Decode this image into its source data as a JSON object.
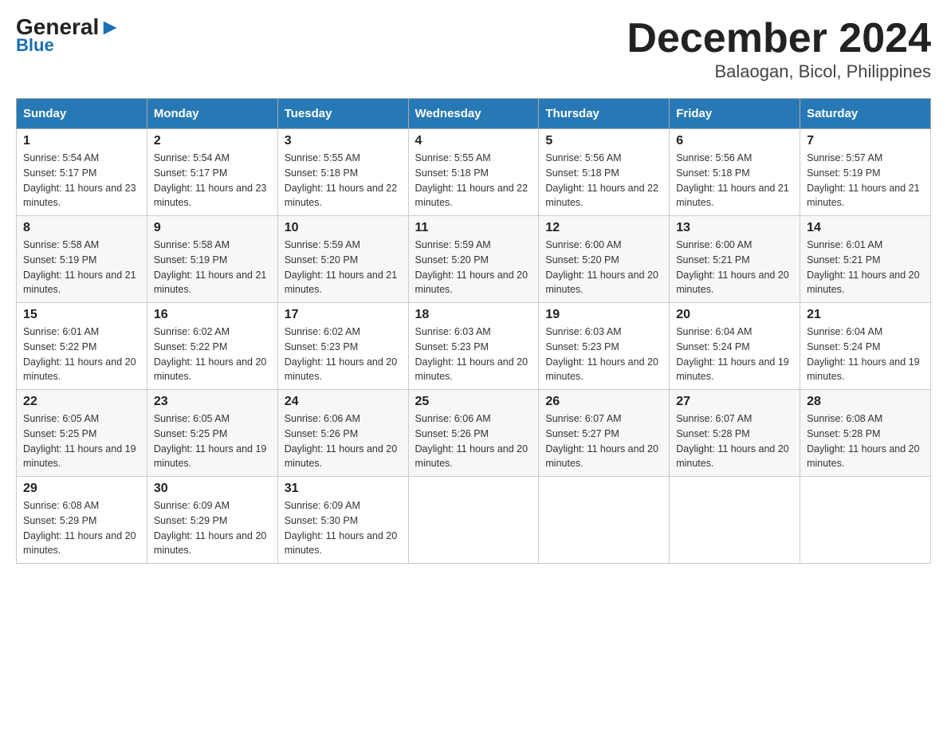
{
  "header": {
    "logo_general": "General",
    "logo_blue": "Blue",
    "title": "December 2024",
    "subtitle": "Balaogan, Bicol, Philippines"
  },
  "columns": [
    "Sunday",
    "Monday",
    "Tuesday",
    "Wednesday",
    "Thursday",
    "Friday",
    "Saturday"
  ],
  "weeks": [
    [
      {
        "day": "1",
        "sunrise": "Sunrise: 5:54 AM",
        "sunset": "Sunset: 5:17 PM",
        "daylight": "Daylight: 11 hours and 23 minutes."
      },
      {
        "day": "2",
        "sunrise": "Sunrise: 5:54 AM",
        "sunset": "Sunset: 5:17 PM",
        "daylight": "Daylight: 11 hours and 23 minutes."
      },
      {
        "day": "3",
        "sunrise": "Sunrise: 5:55 AM",
        "sunset": "Sunset: 5:18 PM",
        "daylight": "Daylight: 11 hours and 22 minutes."
      },
      {
        "day": "4",
        "sunrise": "Sunrise: 5:55 AM",
        "sunset": "Sunset: 5:18 PM",
        "daylight": "Daylight: 11 hours and 22 minutes."
      },
      {
        "day": "5",
        "sunrise": "Sunrise: 5:56 AM",
        "sunset": "Sunset: 5:18 PM",
        "daylight": "Daylight: 11 hours and 22 minutes."
      },
      {
        "day": "6",
        "sunrise": "Sunrise: 5:56 AM",
        "sunset": "Sunset: 5:18 PM",
        "daylight": "Daylight: 11 hours and 21 minutes."
      },
      {
        "day": "7",
        "sunrise": "Sunrise: 5:57 AM",
        "sunset": "Sunset: 5:19 PM",
        "daylight": "Daylight: 11 hours and 21 minutes."
      }
    ],
    [
      {
        "day": "8",
        "sunrise": "Sunrise: 5:58 AM",
        "sunset": "Sunset: 5:19 PM",
        "daylight": "Daylight: 11 hours and 21 minutes."
      },
      {
        "day": "9",
        "sunrise": "Sunrise: 5:58 AM",
        "sunset": "Sunset: 5:19 PM",
        "daylight": "Daylight: 11 hours and 21 minutes."
      },
      {
        "day": "10",
        "sunrise": "Sunrise: 5:59 AM",
        "sunset": "Sunset: 5:20 PM",
        "daylight": "Daylight: 11 hours and 21 minutes."
      },
      {
        "day": "11",
        "sunrise": "Sunrise: 5:59 AM",
        "sunset": "Sunset: 5:20 PM",
        "daylight": "Daylight: 11 hours and 20 minutes."
      },
      {
        "day": "12",
        "sunrise": "Sunrise: 6:00 AM",
        "sunset": "Sunset: 5:20 PM",
        "daylight": "Daylight: 11 hours and 20 minutes."
      },
      {
        "day": "13",
        "sunrise": "Sunrise: 6:00 AM",
        "sunset": "Sunset: 5:21 PM",
        "daylight": "Daylight: 11 hours and 20 minutes."
      },
      {
        "day": "14",
        "sunrise": "Sunrise: 6:01 AM",
        "sunset": "Sunset: 5:21 PM",
        "daylight": "Daylight: 11 hours and 20 minutes."
      }
    ],
    [
      {
        "day": "15",
        "sunrise": "Sunrise: 6:01 AM",
        "sunset": "Sunset: 5:22 PM",
        "daylight": "Daylight: 11 hours and 20 minutes."
      },
      {
        "day": "16",
        "sunrise": "Sunrise: 6:02 AM",
        "sunset": "Sunset: 5:22 PM",
        "daylight": "Daylight: 11 hours and 20 minutes."
      },
      {
        "day": "17",
        "sunrise": "Sunrise: 6:02 AM",
        "sunset": "Sunset: 5:23 PM",
        "daylight": "Daylight: 11 hours and 20 minutes."
      },
      {
        "day": "18",
        "sunrise": "Sunrise: 6:03 AM",
        "sunset": "Sunset: 5:23 PM",
        "daylight": "Daylight: 11 hours and 20 minutes."
      },
      {
        "day": "19",
        "sunrise": "Sunrise: 6:03 AM",
        "sunset": "Sunset: 5:23 PM",
        "daylight": "Daylight: 11 hours and 20 minutes."
      },
      {
        "day": "20",
        "sunrise": "Sunrise: 6:04 AM",
        "sunset": "Sunset: 5:24 PM",
        "daylight": "Daylight: 11 hours and 19 minutes."
      },
      {
        "day": "21",
        "sunrise": "Sunrise: 6:04 AM",
        "sunset": "Sunset: 5:24 PM",
        "daylight": "Daylight: 11 hours and 19 minutes."
      }
    ],
    [
      {
        "day": "22",
        "sunrise": "Sunrise: 6:05 AM",
        "sunset": "Sunset: 5:25 PM",
        "daylight": "Daylight: 11 hours and 19 minutes."
      },
      {
        "day": "23",
        "sunrise": "Sunrise: 6:05 AM",
        "sunset": "Sunset: 5:25 PM",
        "daylight": "Daylight: 11 hours and 19 minutes."
      },
      {
        "day": "24",
        "sunrise": "Sunrise: 6:06 AM",
        "sunset": "Sunset: 5:26 PM",
        "daylight": "Daylight: 11 hours and 20 minutes."
      },
      {
        "day": "25",
        "sunrise": "Sunrise: 6:06 AM",
        "sunset": "Sunset: 5:26 PM",
        "daylight": "Daylight: 11 hours and 20 minutes."
      },
      {
        "day": "26",
        "sunrise": "Sunrise: 6:07 AM",
        "sunset": "Sunset: 5:27 PM",
        "daylight": "Daylight: 11 hours and 20 minutes."
      },
      {
        "day": "27",
        "sunrise": "Sunrise: 6:07 AM",
        "sunset": "Sunset: 5:28 PM",
        "daylight": "Daylight: 11 hours and 20 minutes."
      },
      {
        "day": "28",
        "sunrise": "Sunrise: 6:08 AM",
        "sunset": "Sunset: 5:28 PM",
        "daylight": "Daylight: 11 hours and 20 minutes."
      }
    ],
    [
      {
        "day": "29",
        "sunrise": "Sunrise: 6:08 AM",
        "sunset": "Sunset: 5:29 PM",
        "daylight": "Daylight: 11 hours and 20 minutes."
      },
      {
        "day": "30",
        "sunrise": "Sunrise: 6:09 AM",
        "sunset": "Sunset: 5:29 PM",
        "daylight": "Daylight: 11 hours and 20 minutes."
      },
      {
        "day": "31",
        "sunrise": "Sunrise: 6:09 AM",
        "sunset": "Sunset: 5:30 PM",
        "daylight": "Daylight: 11 hours and 20 minutes."
      },
      null,
      null,
      null,
      null
    ]
  ]
}
